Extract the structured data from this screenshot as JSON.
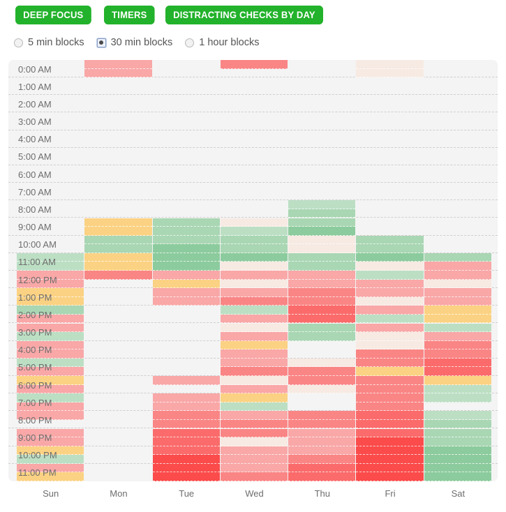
{
  "toolbar": {
    "buttons": [
      {
        "label": "DEEP FOCUS",
        "name": "deep-focus-button"
      },
      {
        "label": "TIMERS",
        "name": "timers-button"
      },
      {
        "label": "DISTRACTING CHECKS BY DAY",
        "name": "distracting-checks-by-day-button"
      }
    ],
    "accent_color": "#22b22b"
  },
  "block_size_options": [
    {
      "label": "5 min blocks",
      "selected": false
    },
    {
      "label": "30 min blocks",
      "selected": true
    },
    {
      "label": "1 hour blocks",
      "selected": false
    }
  ],
  "chart_data": {
    "type": "heatmap",
    "title": "Distracting checks by day",
    "xlabel": "",
    "ylabel": "",
    "grid": true,
    "legend_position": "none",
    "block_size": "30 min blocks",
    "categories": [
      "Sun",
      "Mon",
      "Tue",
      "Wed",
      "Thu",
      "Fri",
      "Sat"
    ],
    "hour_labels": [
      "0:00 AM",
      "1:00 AM",
      "2:00 AM",
      "3:00 AM",
      "4:00 AM",
      "5:00 AM",
      "6:00 AM",
      "7:00 AM",
      "8:00 AM",
      "9:00 AM",
      "10:00 AM",
      "11:00 AM",
      "12:00 PM",
      "1:00 PM",
      "2:00 PM",
      "3:00 PM",
      "4:00 PM",
      "5:00 PM",
      "6:00 PM",
      "7:00 PM",
      "8:00 PM",
      "9:00 PM",
      "10:00 PM",
      "11:00 PM"
    ],
    "colors": {
      "empty": "#f4f4f4",
      "peach": "#f7eae3",
      "red_light": "#f9a7a7",
      "red_mid": "#fa8585",
      "red_strong": "#fb6b6b",
      "red_deep": "#fb4b4b",
      "yellow": "#fbd283",
      "green_light": "#bcdfc4",
      "green_mid": "#a9d6b3",
      "green_strong": "#8ccb9d"
    },
    "slot_minutes": 30,
    "slots_per_day": 48,
    "cells": {
      "Sun": {
        "22": "green_light",
        "23": "green_light",
        "24": "red_light",
        "25": "red_light",
        "26": "yellow",
        "27": "yellow",
        "28": "green_mid",
        "29": "red_light",
        "30": "red_light",
        "31": "green_light",
        "32": "red_light",
        "33": "red_light",
        "34": "green_light",
        "35": "red_light",
        "36": "yellow",
        "37": "red_light",
        "38": "green_light",
        "39": "red_light",
        "40": "red_light",
        "41": "empty",
        "42": "red_light",
        "43": "red_light",
        "44": "yellow",
        "45": "green_light",
        "46": "red_light",
        "47": "yellow"
      },
      "Mon": {
        "0": "red_light",
        "1": "red_light",
        "18": "yellow",
        "19": "yellow",
        "20": "green_mid",
        "21": "green_mid",
        "22": "yellow",
        "23": "yellow",
        "24": "red_mid",
        "25": "empty"
      },
      "Tue": {
        "18": "green_mid",
        "19": "green_mid",
        "20": "green_mid",
        "21": "green_strong",
        "22": "green_strong",
        "23": "green_strong",
        "24": "red_light",
        "25": "yellow",
        "26": "red_light",
        "27": "red_light",
        "36": "red_light",
        "37": "empty",
        "38": "red_light",
        "39": "red_light",
        "40": "red_mid",
        "41": "red_mid",
        "42": "red_strong",
        "43": "red_strong",
        "44": "red_strong",
        "45": "red_deep",
        "46": "red_deep",
        "47": "red_deep"
      },
      "Wed": {
        "0": "red_mid",
        "1": "empty",
        "18": "peach",
        "19": "green_light",
        "20": "green_mid",
        "21": "green_mid",
        "22": "green_strong",
        "23": "peach",
        "24": "red_light",
        "25": "peach",
        "26": "red_light",
        "27": "red_mid",
        "28": "green_light",
        "29": "red_light",
        "30": "peach",
        "31": "red_light",
        "32": "yellow",
        "33": "red_light",
        "34": "red_light",
        "35": "red_mid",
        "36": "peach",
        "37": "red_light",
        "38": "yellow",
        "39": "green_light",
        "40": "red_light",
        "41": "red_mid",
        "42": "red_mid",
        "43": "peach",
        "44": "red_light",
        "45": "red_light",
        "46": "red_light",
        "47": "red_mid"
      },
      "Thu": {
        "16": "green_light",
        "17": "green_mid",
        "18": "green_mid",
        "19": "green_strong",
        "20": "peach",
        "21": "peach",
        "22": "green_mid",
        "23": "green_mid",
        "24": "red_light",
        "25": "red_light",
        "26": "red_mid",
        "27": "red_mid",
        "28": "red_strong",
        "29": "red_strong",
        "30": "green_mid",
        "31": "green_mid",
        "32": "empty",
        "33": "empty",
        "34": "peach",
        "35": "red_mid",
        "36": "red_mid",
        "37": "peach",
        "38": "empty",
        "39": "empty",
        "40": "red_mid",
        "41": "red_mid",
        "42": "red_light",
        "43": "red_light",
        "44": "red_light",
        "45": "red_mid",
        "46": "red_strong",
        "47": "red_strong"
      },
      "Fri": {
        "0": "peach",
        "1": "peach",
        "20": "green_mid",
        "21": "green_mid",
        "22": "green_strong",
        "23": "peach",
        "24": "green_light",
        "25": "red_light",
        "26": "red_light",
        "27": "peach",
        "28": "red_light",
        "29": "green_light",
        "30": "red_light",
        "31": "peach",
        "32": "peach",
        "33": "red_mid",
        "34": "red_mid",
        "35": "yellow",
        "36": "red_mid",
        "37": "red_mid",
        "38": "red_mid",
        "39": "red_mid",
        "40": "red_strong",
        "41": "red_strong",
        "42": "red_strong",
        "43": "red_deep",
        "44": "red_deep",
        "45": "red_deep",
        "46": "red_deep",
        "47": "red_deep"
      },
      "Sat": {
        "22": "green_mid",
        "23": "red_light",
        "24": "red_light",
        "25": "peach",
        "26": "red_light",
        "27": "red_light",
        "28": "yellow",
        "29": "yellow",
        "30": "green_light",
        "31": "red_light",
        "32": "red_mid",
        "33": "red_mid",
        "34": "red_strong",
        "35": "red_strong",
        "36": "yellow",
        "37": "green_light",
        "38": "green_light",
        "39": "empty",
        "40": "green_light",
        "41": "green_mid",
        "42": "green_mid",
        "43": "green_mid",
        "44": "green_strong",
        "45": "green_strong",
        "46": "green_strong",
        "47": "green_strong"
      }
    }
  }
}
